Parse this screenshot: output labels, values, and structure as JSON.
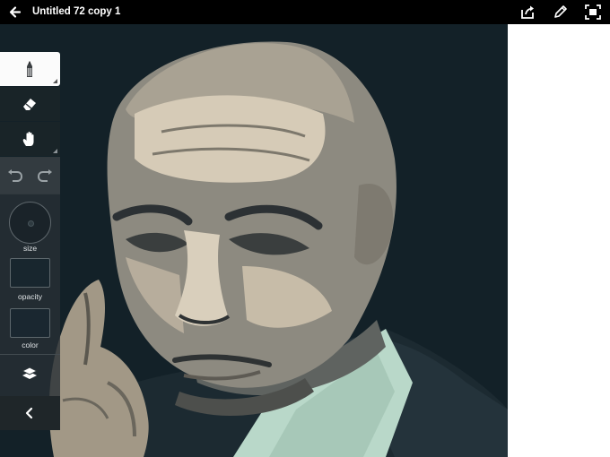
{
  "header": {
    "title": "Untitled 72 copy 1",
    "icons": [
      "back-arrow-icon",
      "share-icon",
      "pencil-icon",
      "fullscreen-icon"
    ]
  },
  "toolbar": {
    "tools": [
      "pencil-icon",
      "eraser-icon",
      "hand-icon"
    ],
    "active_tool": "pencil",
    "undo_icon": "undo-icon",
    "redo_icon": "redo-icon",
    "size_label": "size",
    "opacity_label": "opacity",
    "color_label": "color",
    "layers_icon": "layers-icon",
    "collapse_icon": "chevron-left-icon"
  },
  "colors": {
    "canvas_bg": "#132128",
    "color_swatch": "#1a2730",
    "opacity_swatch": "#18262e",
    "shirt": "#b9d8c9",
    "skin_light": "#d6cbb7"
  }
}
